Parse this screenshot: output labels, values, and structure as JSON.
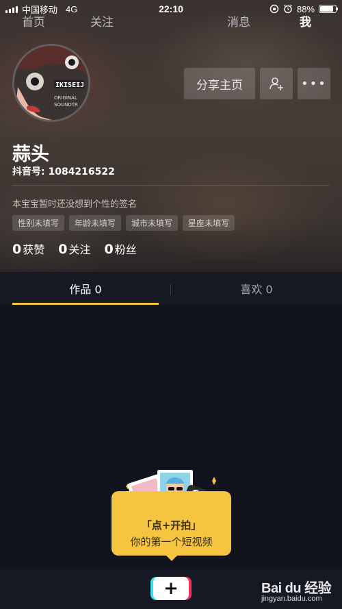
{
  "status_bar": {
    "carrier": "中国移动",
    "network": "4G",
    "time": "22:10",
    "battery": "88%",
    "battery_level": 0.88
  },
  "profile": {
    "nickname": "蒜头",
    "douyin_id": "抖音号: 1084216522",
    "signature": "本宝宝暂时还没想到个性的签名",
    "tags": [
      "性别未填写",
      "年龄未填写",
      "城市未填写",
      "星座未填写"
    ],
    "stats": [
      {
        "value": "0",
        "label": "获赞"
      },
      {
        "value": "0",
        "label": "关注"
      },
      {
        "value": "0",
        "label": "粉丝"
      }
    ],
    "avatar_text": [
      "IKISEIJ",
      "ORIGINAL",
      "SOUNDTR"
    ]
  },
  "actions": {
    "share_label": "分享主页",
    "add_friend_icon": "add-user-icon",
    "more_icon": "more-icon",
    "more_glyph": "•••"
  },
  "tabs": [
    {
      "label": "作品 0",
      "active": true
    },
    {
      "label": "喜欢 0",
      "active": false
    }
  ],
  "prompt": {
    "line1": "「点+开拍」",
    "line2": "你的第一个短视频"
  },
  "bottom_nav": {
    "home": "首页",
    "follow": "关注",
    "add": "+",
    "messages": "消息",
    "me": "我"
  },
  "watermark": {
    "brand": "Bai du 经验",
    "url": "jingyan.baidu.com"
  },
  "colors": {
    "accent": "#f5c542",
    "background": "#11131d",
    "tab_bar": "#161823"
  }
}
